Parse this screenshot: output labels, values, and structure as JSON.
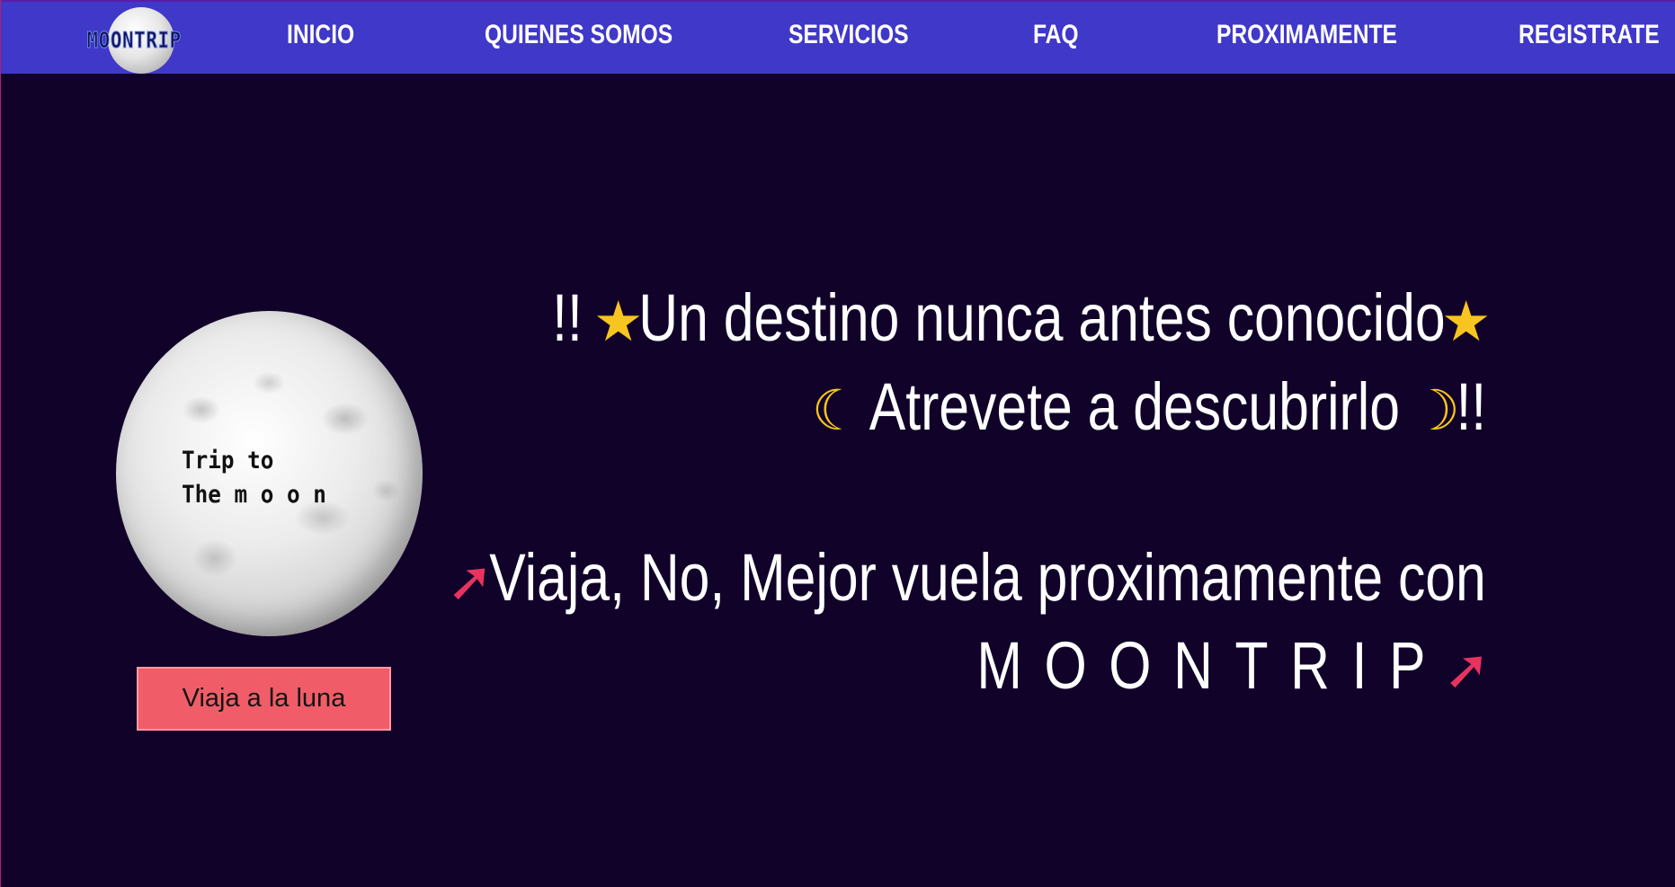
{
  "navbar": {
    "logo_text": "MOONTRIP",
    "links": [
      {
        "label": "INICIO"
      },
      {
        "label": "QUIENES SOMOS"
      },
      {
        "label": "SERVICIOS"
      },
      {
        "label": "FAQ"
      },
      {
        "label": "PROXIMAMENTE"
      },
      {
        "label": "REGISTRATE"
      }
    ]
  },
  "moon": {
    "line1": "Trip to",
    "line2": "The m o o n"
  },
  "cta": {
    "label": "Viaja a la luna"
  },
  "hero": {
    "line1_prefix": "!!",
    "line1_text": "Un destino nunca antes conocido",
    "line2_text": "Atrevete a descubrirlo",
    "line2_suffix": "!!",
    "line3_text": "Viaja, No, Mejor vuela proximamente con",
    "line4_text": "MOONTRIP"
  },
  "icons": {
    "star": "star-icon",
    "moon_left": "crescent-moon-face-icon",
    "moon_right": "crescent-moon-face-icon",
    "rocket": "rocket-icon"
  },
  "colors": {
    "navbar_bg": "#4038c9",
    "page_bg": "#11022a",
    "button_bg": "#f05d68",
    "text": "#ffffff",
    "emoji_yellow": "#f7c51f"
  }
}
